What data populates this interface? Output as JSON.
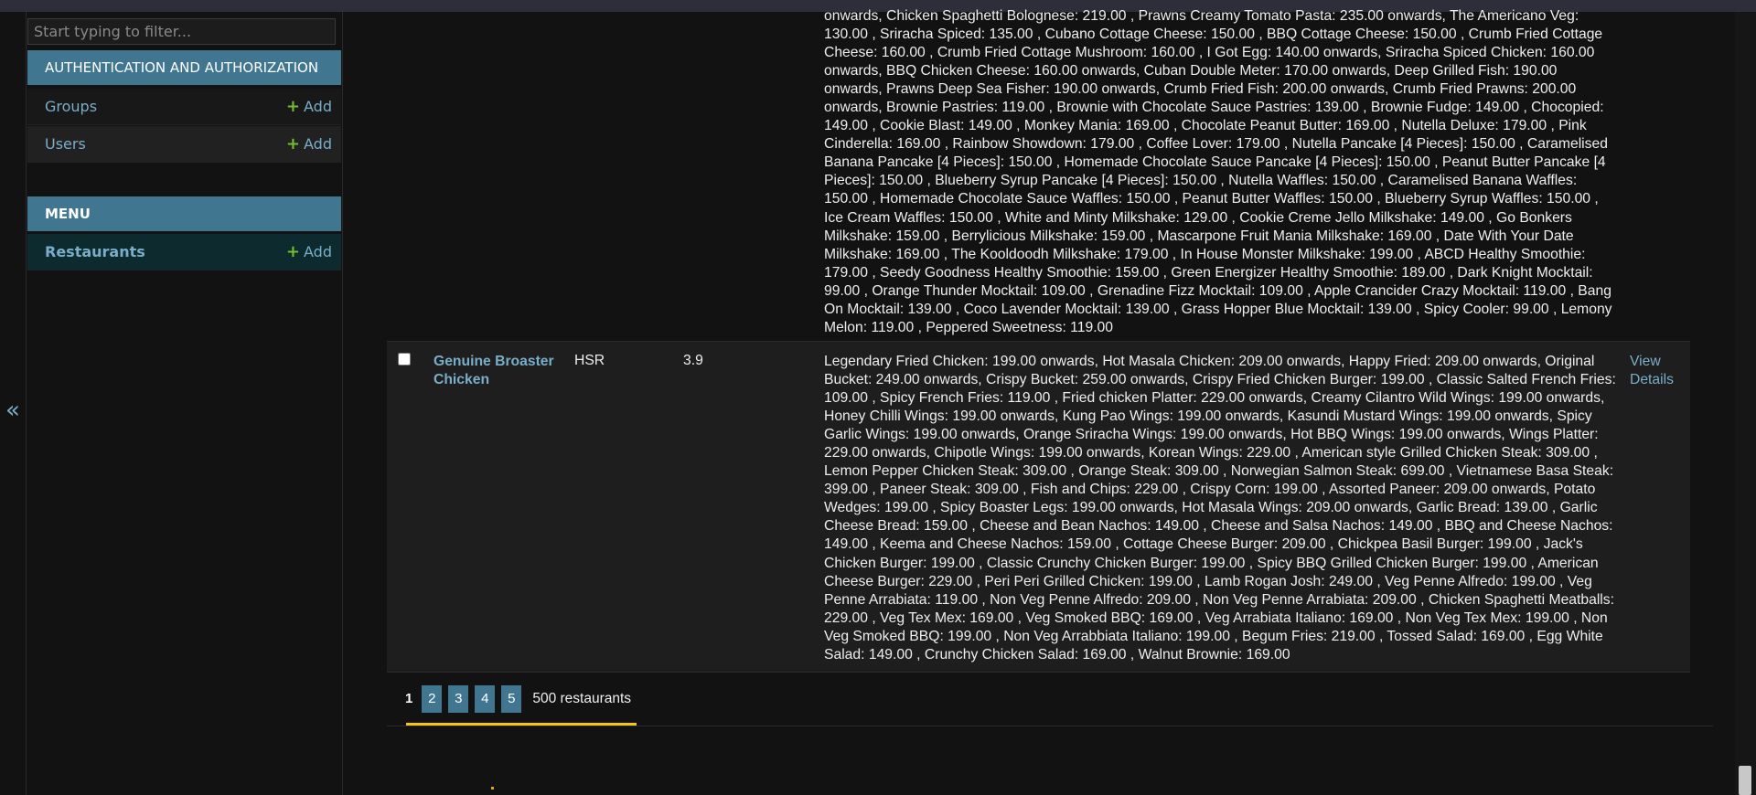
{
  "sidebar": {
    "filter_placeholder": "Start typing to filter...",
    "modules": [
      {
        "caption": "AUTHENTICATION AND AUTHORIZATION",
        "models": [
          {
            "label": "Groups",
            "add_label": "Add"
          },
          {
            "label": "Users",
            "add_label": "Add"
          }
        ]
      },
      {
        "caption": "MENU",
        "models": [
          {
            "label": "Restaurants",
            "add_label": "Add"
          }
        ]
      }
    ],
    "collapse_glyph": "«"
  },
  "results": {
    "previous_row_menu_tail": "onwards, Chicken Spaghetti Bolognese: 219.00 , Prawns Creamy Tomato Pasta: 235.00 onwards, The Americano Veg: 130.00 , Sriracha Spiced: 135.00 , Cubano Cottage Cheese: 150.00 , BBQ Cottage Cheese: 150.00 , Crumb Fried Cottage Cheese: 160.00 , Crumb Fried Cottage Mushroom: 160.00 , I Got Egg: 140.00 onwards, Sriracha Spiced Chicken: 160.00 onwards, BBQ Chicken Cheese: 160.00 onwards, Cuban Double Meter: 170.00 onwards, Deep Grilled Fish: 190.00 onwards, Prawns Deep Sea Fisher: 190.00 onwards, Crumb Fried Fish: 200.00 onwards, Crumb Fried Prawns: 200.00 onwards, Brownie Pastries: 119.00 , Brownie with Chocolate Sauce Pastries: 139.00 , Brownie Fudge: 149.00 , Chocopied: 149.00 , Cookie Blast: 149.00 , Monkey Mania: 169.00 , Chocolate Peanut Butter: 169.00 , Nutella Deluxe: 179.00 , Pink Cinderella: 169.00 , Rainbow Showdown: 179.00 , Coffee Lover: 179.00 , Nutella Pancake [4 Pieces]: 150.00 , Caramelised Banana Pancake [4 Pieces]: 150.00 , Homemade Chocolate Sauce Pancake [4 Pieces]: 150.00 , Peanut Butter Pancake [4 Pieces]: 150.00 , Blueberry Syrup Pancake [4 Pieces]: 150.00 , Nutella Waffles: 150.00 , Caramelised Banana Waffles: 150.00 , Homemade Chocolate Sauce Waffles: 150.00 , Peanut Butter Waffles: 150.00 , Blueberry Syrup Waffles: 150.00 , Ice Cream Waffles: 150.00 , White and Minty Milkshake: 129.00 , Cookie Creme Jello Milkshake: 149.00 , Go Bonkers Milkshake: 159.00 , Berrylicious Milkshake: 159.00 , Mascarpone Fruit Mania Milkshake: 169.00 , Date With Your Date Milkshake: 169.00 , The Kooldoodh Milkshake: 179.00 , In House Monster Milkshake: 199.00 , ABCD Healthy Smoothie: 179.00 , Seedy Goodness Healthy Smoothie: 159.00 , Green Energizer Healthy Smoothie: 189.00 , Dark Knight Mocktail: 99.00 , Orange Thunder Mocktail: 109.00 , Grenadine Fizz Mocktail: 109.00 , Apple Crancider Crazy Mocktail: 119.00 , Bang On Mocktail: 139.00 , Coco Lavender Mocktail: 139.00 , Grass Hopper Blue Mocktail: 139.00 , Spicy Cooler: 99.00 , Lemony Melon: 119.00 , Peppered Sweetness: 119.00",
    "row": {
      "name": "Genuine Broaster Chicken",
      "location": "HSR",
      "rating": "3.9",
      "menu": "Legendary Fried Chicken: 199.00 onwards, Hot Masala Chicken: 209.00 onwards, Happy Fried: 209.00 onwards, Original Bucket: 249.00 onwards, Crispy Bucket: 259.00 onwards, Crispy Fried Chicken Burger: 199.00 , Classic Salted French Fries: 109.00 , Spicy French Fries: 119.00 , Fried chicken Platter: 229.00 onwards, Creamy Cilantro Wild Wings: 199.00 onwards, Honey Chilli Wings: 199.00 onwards, Kung Pao Wings: 199.00 onwards, Kasundi Mustard Wings: 199.00 onwards, Spicy Garlic Wings: 199.00 onwards, Orange Sriracha Wings: 199.00 onwards, Hot BBQ Wings: 199.00 onwards, Wings Platter: 229.00 onwards, Chipotle Wings: 199.00 onwards, Korean Wings: 229.00 , American style Grilled Chicken Steak: 309.00 , Lemon Pepper Chicken Steak: 309.00 , Orange Steak: 309.00 , Norwegian Salmon Steak: 699.00 , Vietnamese Basa Steak: 399.00 , Paneer Steak: 309.00 , Fish and Chips: 229.00 , Crispy Corn: 199.00 , Assorted Paneer: 209.00 onwards, Potato Wedges: 199.00 , Spicy Boaster Legs: 199.00 onwards, Hot Masala Wings: 209.00 onwards, Garlic Bread: 139.00 , Garlic Cheese Bread: 159.00 , Cheese and Bean Nachos: 149.00 , Cheese and Salsa Nachos: 149.00 , BBQ and Cheese Nachos: 149.00 , Keema and Cheese Nachos: 159.00 , Cottage Cheese Burger: 209.00 , Chickpea Basil Burger: 199.00 , Jack's Chicken Burger: 199.00 , Classic Crunchy Chicken Burger: 199.00 , Spicy BBQ Grilled Chicken Burger: 199.00 , American Cheese Burger: 229.00 , Peri Peri Grilled Chicken: 199.00 , Lamb Rogan Josh: 249.00 , Veg Penne Alfredo: 199.00 , Veg Penne Arrabiata: 119.00 , Non Veg Penne Alfredo: 209.00 , Non Veg Penne Arrabiata: 209.00 , Chicken Spaghetti Meatballs: 229.00 , Veg Tex Mex: 169.00 , Veg Smoked BBQ: 169.00 , Veg Arrabiata Italiano: 169.00 , Non Veg Tex Mex: 199.00 , Non Veg Smoked BBQ: 199.00 , Non Veg Arrabbiata Italiano: 199.00 , Begum Fries: 219.00 , Tossed Salad: 169.00 , Egg White Salad: 149.00 , Crunchy Chicken Salad: 169.00 , Walnut Brownie: 169.00",
      "view_details": "View Details"
    },
    "pagination": {
      "current_page": "1",
      "pages": [
        "2",
        "3",
        "4",
        "5"
      ],
      "count_text": "500 restaurants"
    }
  },
  "colors": {
    "accent_link": "#79aec8",
    "module_header": "#417690",
    "add_plus": "#70bf2b",
    "paginator_underline": "#f5c518"
  }
}
